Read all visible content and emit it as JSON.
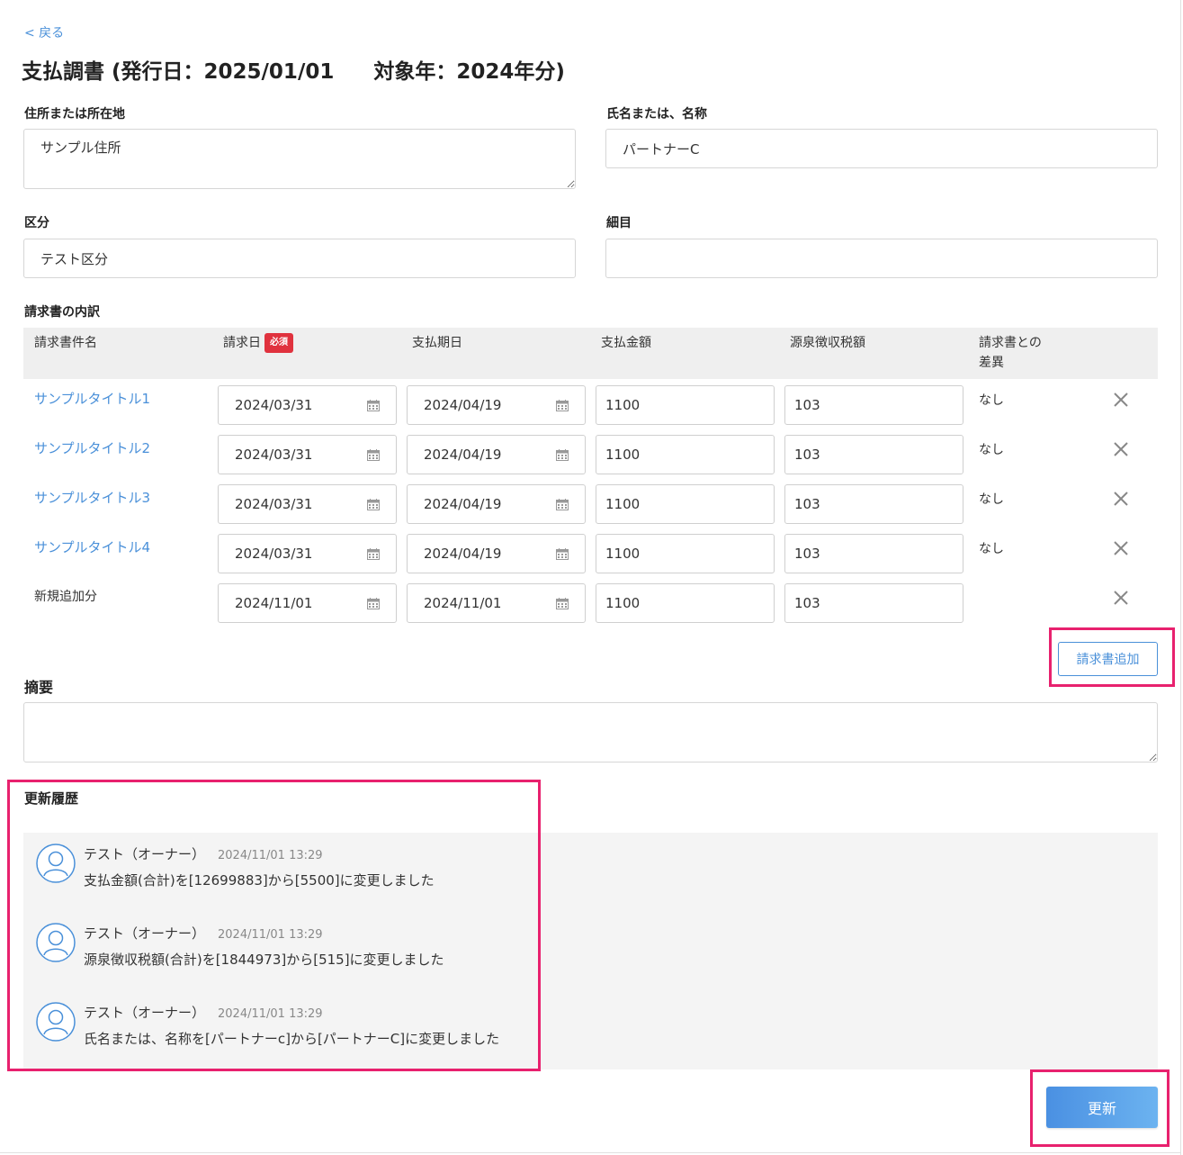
{
  "back_label": "< 戻る",
  "title": {
    "main": "支払調書 (発行日：2025/01/01",
    "target": "対象年：2024年分)"
  },
  "form": {
    "address_label": "住所または所在地",
    "address_value": "サンプル住所",
    "name_label": "氏名または、名称",
    "name_value": "パートナーC",
    "category_label": "区分",
    "category_value": "テスト区分",
    "detail_label": "細目",
    "detail_value": ""
  },
  "invoice_table": {
    "section_label": "請求書の内訳",
    "headers": {
      "title": "請求書件名",
      "invoice_date": "請求日",
      "required_badge": "必須",
      "due_date": "支払期日",
      "amount": "支払金額",
      "withholding": "源泉徴収税額",
      "diff_line1": "請求書との",
      "diff_line2": "差異"
    },
    "rows": [
      {
        "title": "サンプルタイトル1",
        "invoice_date": "2024/03/31",
        "due_date": "2024/04/19",
        "amount": "1100",
        "withholding": "103",
        "diff": "なし"
      },
      {
        "title": "サンプルタイトル2",
        "invoice_date": "2024/03/31",
        "due_date": "2024/04/19",
        "amount": "1100",
        "withholding": "103",
        "diff": "なし"
      },
      {
        "title": "サンプルタイトル3",
        "invoice_date": "2024/03/31",
        "due_date": "2024/04/19",
        "amount": "1100",
        "withholding": "103",
        "diff": "なし"
      },
      {
        "title": "サンプルタイトル4",
        "invoice_date": "2024/03/31",
        "due_date": "2024/04/19",
        "amount": "1100",
        "withholding": "103",
        "diff": "なし"
      },
      {
        "title": "新規追加分",
        "invoice_date": "2024/11/01",
        "due_date": "2024/11/01",
        "amount": "1100",
        "withholding": "103",
        "diff": ""
      }
    ],
    "add_button": "請求書追加"
  },
  "summary": {
    "label": "摘要",
    "value": ""
  },
  "history": {
    "label": "更新履歴",
    "entries": [
      {
        "user": "テスト（オーナー）",
        "time": "2024/11/01 13:29",
        "message": "支払金額(合計)を[12699883]から[5500]に変更しました"
      },
      {
        "user": "テスト（オーナー）",
        "time": "2024/11/01 13:29",
        "message": "源泉徴収税額(合計)を[1844973]から[515]に変更しました"
      },
      {
        "user": "テスト（オーナー）",
        "time": "2024/11/01 13:29",
        "message": "氏名または、名称を[パートナーc]から[パートナーC]に変更しました"
      }
    ]
  },
  "update_button": "更新",
  "colors": {
    "link": "#4a90d9",
    "required_badge": "#e0323e",
    "highlight": "#e8216e",
    "primary_button": "#4a90e2"
  },
  "icons": {
    "calendar": "calendar-icon",
    "delete": "close-icon",
    "avatar": "user-avatar-icon"
  }
}
